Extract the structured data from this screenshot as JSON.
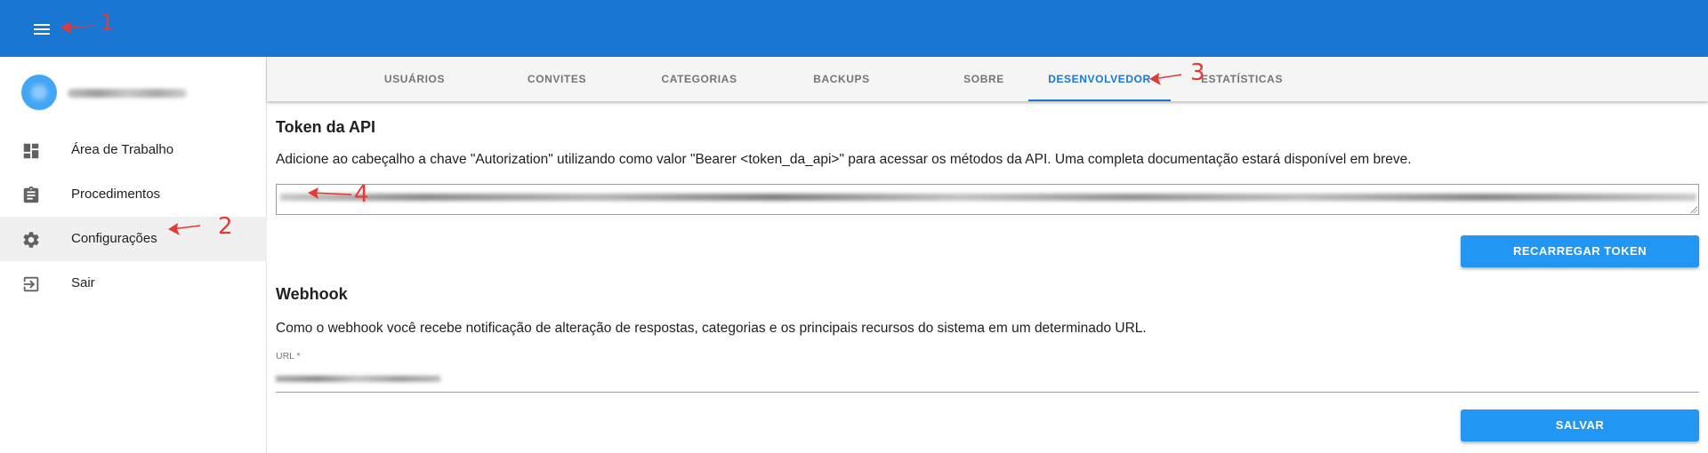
{
  "topbar": {
    "menu_icon": "menu-icon",
    "color": "#1976d2"
  },
  "sidebar": {
    "items": [
      {
        "label": "Área de Trabalho",
        "icon": "dashboard-icon"
      },
      {
        "label": "Procedimentos",
        "icon": "clipboard-icon"
      },
      {
        "label": "Configurações",
        "icon": "gear-icon",
        "active": true
      },
      {
        "label": "Sair",
        "icon": "exit-icon"
      }
    ]
  },
  "tabs": [
    {
      "label": "USUÁRIOS"
    },
    {
      "label": "CONVITES"
    },
    {
      "label": "CATEGORIAS"
    },
    {
      "label": "BACKUPS"
    },
    {
      "label": "SOBRE"
    },
    {
      "label": "DESENVOLVEDOR",
      "active": true
    },
    {
      "label": "ESTATÍSTICAS"
    }
  ],
  "token": {
    "heading": "Token da API",
    "description": "Adicione ao cabeçalho a chave \"Autorization\" utilizando como valor \"Bearer <token_da_api>\" para acessar os métodos da API. Uma completa documentação estará disponível em breve.",
    "reload_button": "RECARREGAR TOKEN"
  },
  "webhook": {
    "heading": "Webhook",
    "description": "Como o webhook você recebe notificação de alteração de respostas, categorias e os principais recursos do sistema em um determinado URL.",
    "url_label": "URL *",
    "save_button": "SALVAR"
  },
  "annotations": [
    "1",
    "2",
    "3",
    "4"
  ],
  "colors": {
    "accent": "#2196f3",
    "annotation": "#e53935"
  }
}
